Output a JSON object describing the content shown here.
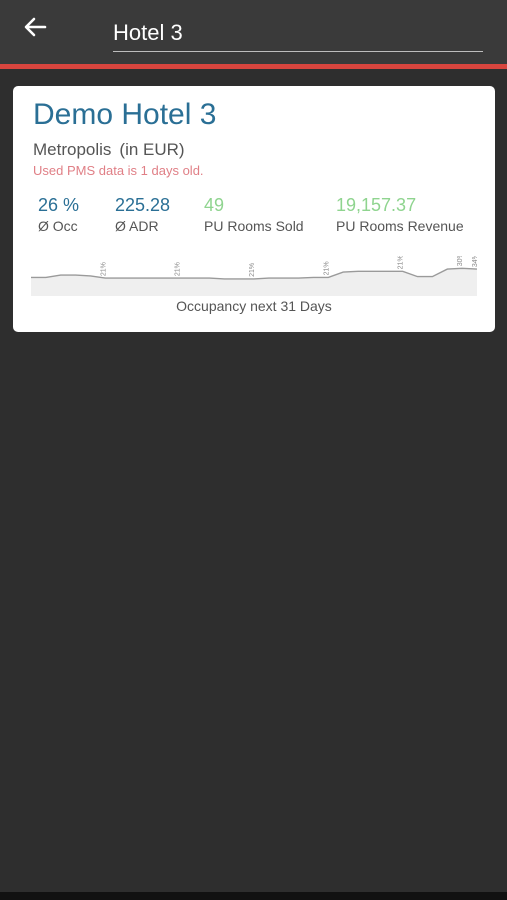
{
  "header": {
    "search_value": "Hotel 3"
  },
  "card": {
    "hotel_name": "Demo Hotel 3",
    "city": "Metropolis",
    "currency_note": "(in EUR)",
    "data_age_warning": "Used PMS data is 1 days old.",
    "kpis": [
      {
        "value": "26 %",
        "label": "Ø Occ"
      },
      {
        "value": "225.28",
        "label": "Ø ADR"
      },
      {
        "value": "49",
        "label": "PU Rooms Sold"
      },
      {
        "value": "19,157.37",
        "label": "PU Rooms Revenue"
      }
    ],
    "chart_caption": "Occupancy next 31 Days"
  },
  "colors": {
    "accent": "#d8453e",
    "title_blue": "#2a6f95",
    "pickup_green": "#8fd48f",
    "warning_pink": "#e07f86"
  },
  "chart_data": {
    "type": "area",
    "title": "Occupancy next 31 Days",
    "x": [
      1,
      2,
      3,
      4,
      5,
      6,
      7,
      8,
      9,
      10,
      11,
      12,
      13,
      14,
      15,
      16,
      17,
      18,
      19,
      20,
      21,
      22,
      23,
      24,
      25,
      26,
      27,
      28,
      29,
      30,
      31
    ],
    "series": [
      {
        "values": [
          22,
          22,
          25,
          25,
          24,
          21,
          21,
          21,
          21,
          21,
          21,
          21,
          21,
          20,
          20,
          20,
          21,
          21,
          21,
          22,
          22,
          29,
          30,
          30,
          30,
          30,
          23,
          23,
          33,
          34,
          33
        ]
      }
    ],
    "data_labels": [
      "21%",
      "21%",
      "21%",
      "21%",
      "21%",
      "21%",
      "30%",
      "34%"
    ]
  }
}
